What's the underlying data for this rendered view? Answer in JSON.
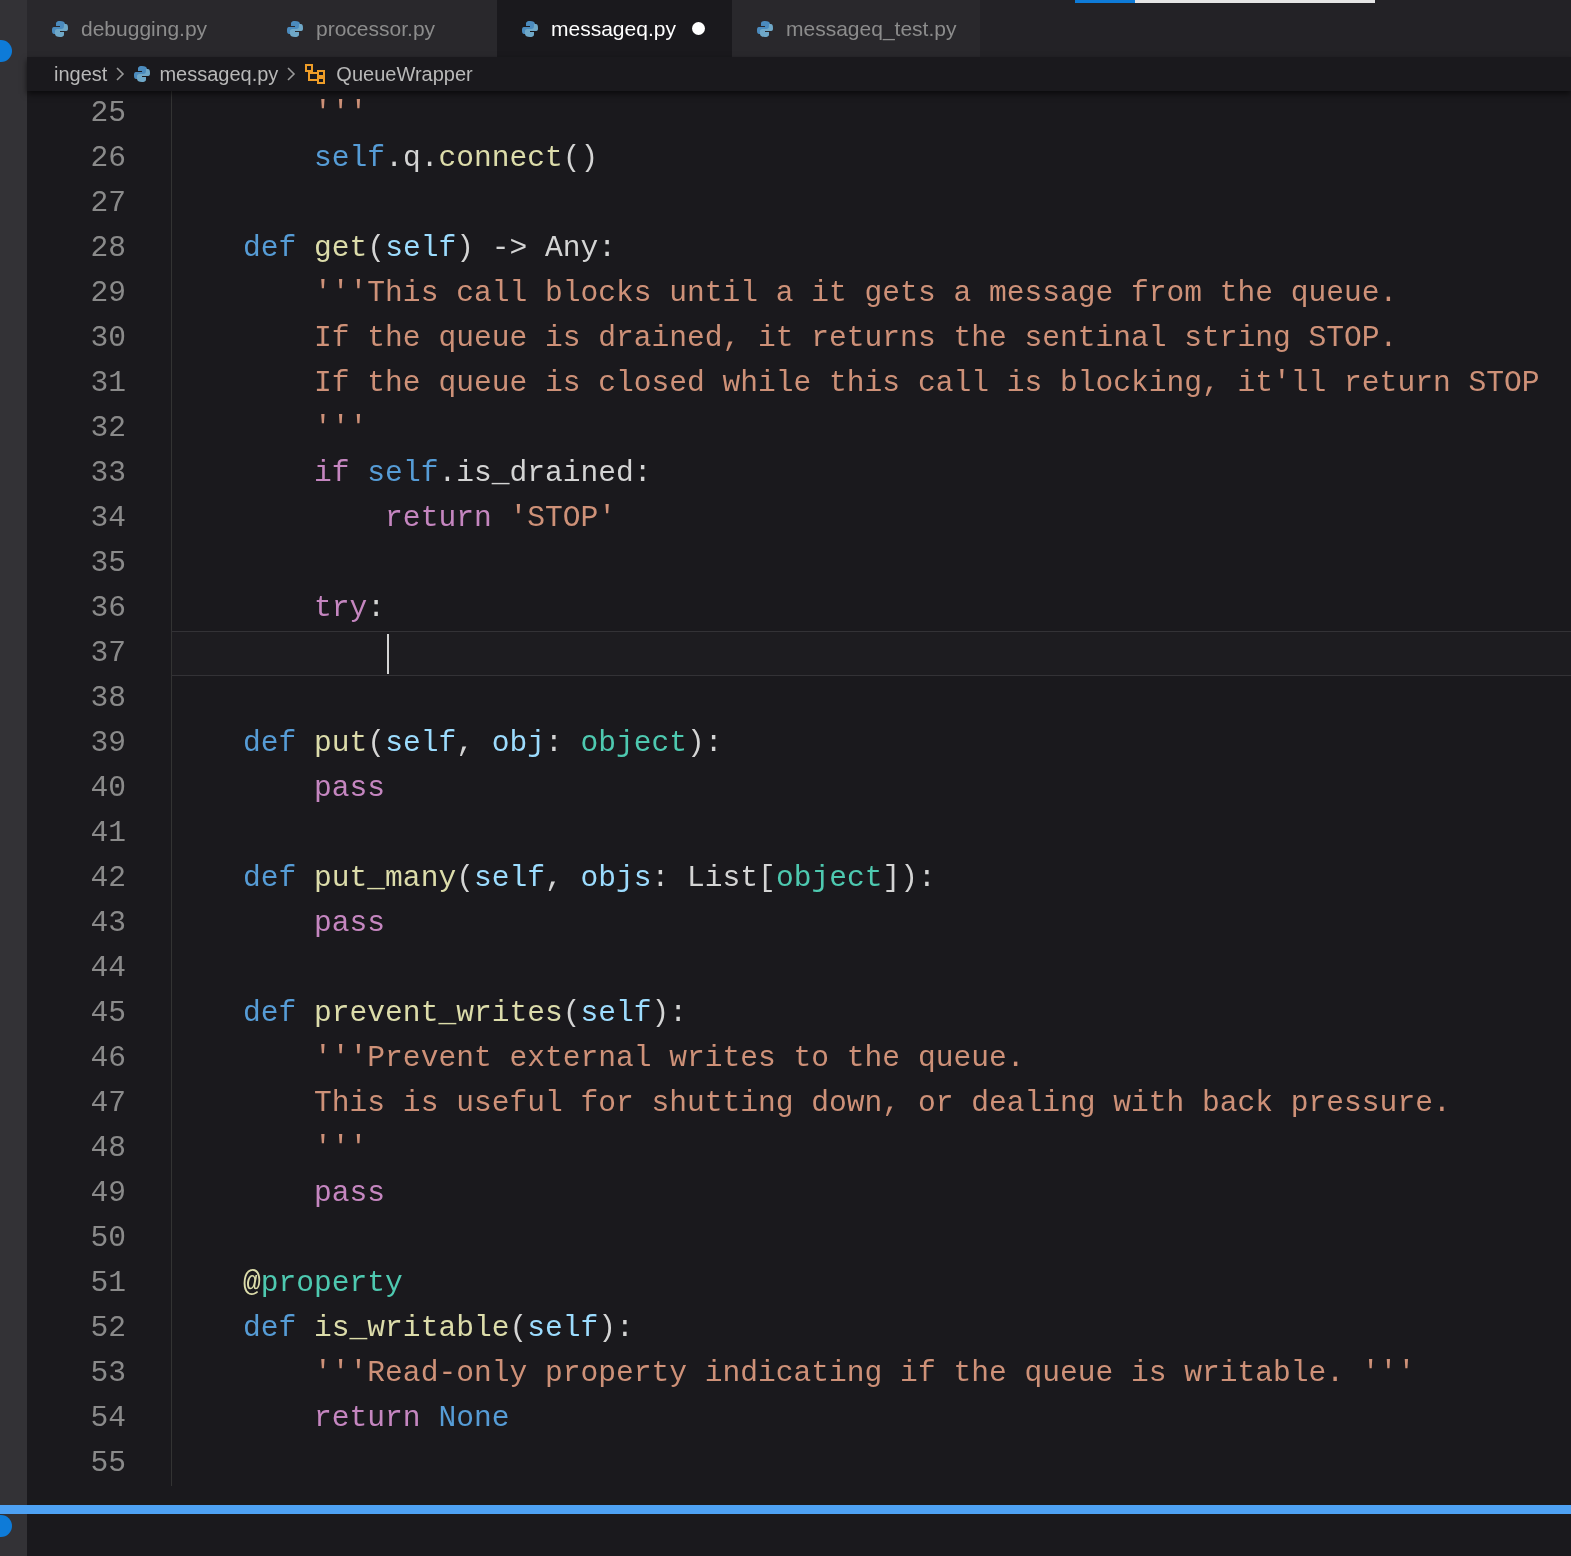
{
  "progress": {
    "level": 0.2
  },
  "tabs": [
    {
      "label": "debugging.py",
      "selected": false,
      "modified": false
    },
    {
      "label": "processor.py",
      "selected": false,
      "modified": false
    },
    {
      "label": "messageq.py",
      "selected": true,
      "modified": true
    },
    {
      "label": "messageq_test.py",
      "selected": false,
      "modified": false
    }
  ],
  "breadcrumb": [
    {
      "label": "ingest",
      "kind": "folder"
    },
    {
      "label": "messageq.py",
      "kind": "file"
    },
    {
      "label": "QueueWrapper",
      "kind": "class"
    }
  ],
  "lines": [
    {
      "number": "25",
      "current": false,
      "tokens": [
        {
          "t": "        '''",
          "kind": "str"
        }
      ]
    },
    {
      "number": "26",
      "current": false,
      "tokens": [
        {
          "t": "        self",
          "kind": "self"
        },
        {
          "t": ".q.",
          "kind": "plain"
        },
        {
          "t": "connect",
          "kind": "fn"
        },
        {
          "t": "()",
          "kind": "plain"
        }
      ]
    },
    {
      "number": "27",
      "current": false
    },
    {
      "number": "28",
      "current": false,
      "tokens": [
        {
          "t": "    def ",
          "kind": "kw"
        },
        {
          "t": "get",
          "kind": "fn"
        },
        {
          "t": "(",
          "kind": "plain"
        },
        {
          "t": "self",
          "kind": "param"
        },
        {
          "t": ") -> Any:",
          "kind": "plain"
        }
      ]
    },
    {
      "number": "29",
      "current": false,
      "tokens": [
        {
          "t": "        '''This call blocks until a it gets a message from the queue.",
          "kind": "str"
        }
      ]
    },
    {
      "number": "30",
      "current": false,
      "tokens": [
        {
          "t": "        If the queue is drained, it returns the sentinal string STOP.",
          "kind": "str"
        }
      ]
    },
    {
      "number": "31",
      "current": false,
      "tokens": [
        {
          "t": "        If the queue is closed while this call is blocking, it'll return STOP",
          "kind": "str"
        }
      ]
    },
    {
      "number": "32",
      "current": false,
      "tokens": [
        {
          "t": "        '''",
          "kind": "str"
        }
      ]
    },
    {
      "number": "33",
      "current": false,
      "tokens": [
        {
          "t": "        if ",
          "kind": "ctrl"
        },
        {
          "t": "self",
          "kind": "self"
        },
        {
          "t": ".is_drained:",
          "kind": "plain"
        }
      ]
    },
    {
      "number": "34",
      "current": false,
      "tokens": [
        {
          "t": "            return ",
          "kind": "ctrl"
        },
        {
          "t": "'STOP'",
          "kind": "str"
        }
      ]
    },
    {
      "number": "35",
      "current": false
    },
    {
      "number": "36",
      "current": false,
      "tokens": [
        {
          "t": "        try",
          "kind": "ctrl"
        },
        {
          "t": ":",
          "kind": "plain"
        }
      ]
    },
    {
      "number": "37",
      "current": true
    },
    {
      "number": "38",
      "current": false
    },
    {
      "number": "39",
      "current": false,
      "tokens": [
        {
          "t": "    def ",
          "kind": "kw"
        },
        {
          "t": "put",
          "kind": "fn"
        },
        {
          "t": "(",
          "kind": "plain"
        },
        {
          "t": "self",
          "kind": "param"
        },
        {
          "t": ", ",
          "kind": "plain"
        },
        {
          "t": "obj",
          "kind": "param"
        },
        {
          "t": ": ",
          "kind": "plain"
        },
        {
          "t": "object",
          "kind": "type"
        },
        {
          "t": "):",
          "kind": "plain"
        }
      ]
    },
    {
      "number": "40",
      "current": false,
      "tokens": [
        {
          "t": "        pass",
          "kind": "ctrl"
        }
      ]
    },
    {
      "number": "41",
      "current": false
    },
    {
      "number": "42",
      "current": false,
      "tokens": [
        {
          "t": "    def ",
          "kind": "kw"
        },
        {
          "t": "put_many",
          "kind": "fn"
        },
        {
          "t": "(",
          "kind": "plain"
        },
        {
          "t": "self",
          "kind": "param"
        },
        {
          "t": ", ",
          "kind": "plain"
        },
        {
          "t": "objs",
          "kind": "param"
        },
        {
          "t": ": List[",
          "kind": "plain"
        },
        {
          "t": "object",
          "kind": "type"
        },
        {
          "t": "]):",
          "kind": "plain"
        }
      ]
    },
    {
      "number": "43",
      "current": false,
      "tokens": [
        {
          "t": "        pass",
          "kind": "ctrl"
        }
      ]
    },
    {
      "number": "44",
      "current": false
    },
    {
      "number": "45",
      "current": false,
      "tokens": [
        {
          "t": "    def ",
          "kind": "kw"
        },
        {
          "t": "prevent_writes",
          "kind": "fn"
        },
        {
          "t": "(",
          "kind": "plain"
        },
        {
          "t": "self",
          "kind": "param"
        },
        {
          "t": "):",
          "kind": "plain"
        }
      ]
    },
    {
      "number": "46",
      "current": false,
      "tokens": [
        {
          "t": "        '''Prevent external writes to the queue.",
          "kind": "str"
        }
      ]
    },
    {
      "number": "47",
      "current": false,
      "tokens": [
        {
          "t": "        This is useful for shutting down, or dealing with back pressure.",
          "kind": "str"
        }
      ]
    },
    {
      "number": "48",
      "current": false,
      "tokens": [
        {
          "t": "        '''",
          "kind": "str"
        }
      ]
    },
    {
      "number": "49",
      "current": false,
      "tokens": [
        {
          "t": "        pass",
          "kind": "ctrl"
        }
      ]
    },
    {
      "number": "50",
      "current": false
    },
    {
      "number": "51",
      "current": false,
      "tokens": [
        {
          "t": "    @",
          "kind": "fn"
        },
        {
          "t": "property",
          "kind": "type"
        }
      ]
    },
    {
      "number": "52",
      "current": false,
      "tokens": [
        {
          "t": "    def ",
          "kind": "kw"
        },
        {
          "t": "is_writable",
          "kind": "fn"
        },
        {
          "t": "(",
          "kind": "plain"
        },
        {
          "t": "self",
          "kind": "param"
        },
        {
          "t": "):",
          "kind": "plain"
        }
      ]
    },
    {
      "number": "53",
      "current": false,
      "tokens": [
        {
          "t": "        '''Read-only property indicating if the queue is writable. '''",
          "kind": "str"
        }
      ]
    },
    {
      "number": "54",
      "current": false,
      "tokens": [
        {
          "t": "        return ",
          "kind": "ctrl"
        },
        {
          "t": "None",
          "kind": "kw"
        }
      ]
    },
    {
      "number": "55",
      "current": false
    }
  ]
}
